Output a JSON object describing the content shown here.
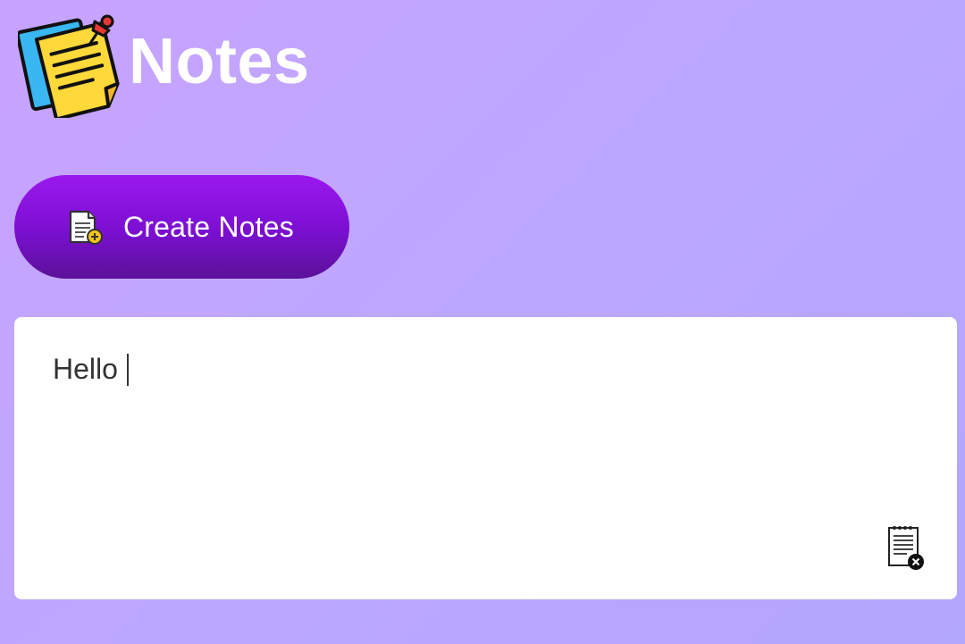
{
  "header": {
    "title": "Notes",
    "logo_icon": "sticky-notes-icon"
  },
  "toolbar": {
    "create_label": "Create Notes",
    "create_icon": "new-note-icon"
  },
  "notes": [
    {
      "text": "Hello",
      "delete_icon": "delete-note-icon"
    }
  ],
  "colors": {
    "background_start": "#c7a3ff",
    "background_end": "#b3a6fd",
    "button_top": "#9b18ee",
    "button_bottom": "#5b1199",
    "card": "#ffffff"
  }
}
